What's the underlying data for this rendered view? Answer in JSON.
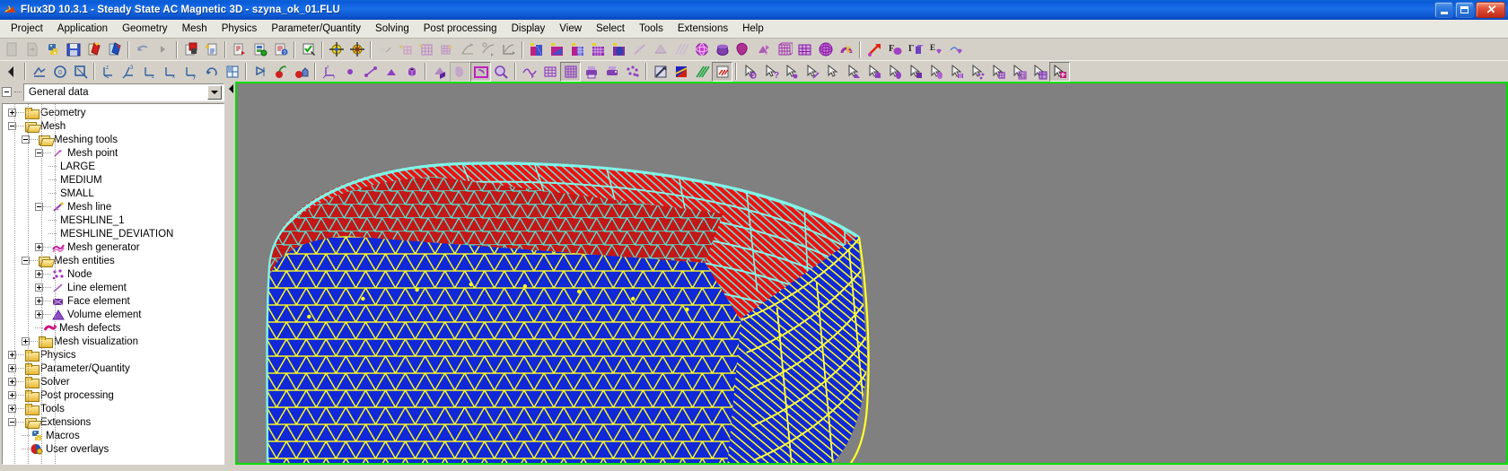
{
  "window": {
    "title": "Flux3D 10.3.1 - Steady State AC Magnetic 3D - szyna_ok_01.FLU",
    "app_icon": "flux3d-app-icon",
    "minimize_label": "",
    "restore_label": "",
    "close_label": "✕"
  },
  "menubar": {
    "items": [
      {
        "label": "Project",
        "name": "menu-project"
      },
      {
        "label": "Application",
        "name": "menu-application"
      },
      {
        "label": "Geometry",
        "name": "menu-geometry"
      },
      {
        "label": "Mesh",
        "name": "menu-mesh"
      },
      {
        "label": "Physics",
        "name": "menu-physics"
      },
      {
        "label": "Parameter/Quantity",
        "name": "menu-parameter-quantity"
      },
      {
        "label": "Solving",
        "name": "menu-solving"
      },
      {
        "label": "Post processing",
        "name": "menu-post-processing"
      },
      {
        "label": "Display",
        "name": "menu-display"
      },
      {
        "label": "View",
        "name": "menu-view"
      },
      {
        "label": "Select",
        "name": "menu-select"
      },
      {
        "label": "Tools",
        "name": "menu-tools"
      },
      {
        "label": "Extensions",
        "name": "menu-extensions"
      },
      {
        "label": "Help",
        "name": "menu-help"
      }
    ]
  },
  "toolbar_row1": {
    "buttons": [
      {
        "name": "new-project-icon",
        "kind": "page",
        "disabled": true
      },
      {
        "name": "open-project-icon",
        "kind": "page-arrow",
        "disabled": true
      },
      {
        "name": "python-macro-icon",
        "kind": "python",
        "disabled": false
      },
      {
        "name": "save-project-icon",
        "kind": "floppy",
        "disabled": false
      },
      {
        "name": "import-geometry-icon",
        "kind": "book-red",
        "disabled": false
      },
      {
        "name": "export-icon",
        "kind": "book-blue",
        "disabled": false
      },
      {
        "sep": true
      },
      {
        "name": "undo-icon",
        "kind": "undo",
        "disabled": true
      },
      {
        "name": "redo-icon",
        "kind": "redo-small",
        "disabled": true
      },
      {
        "sep": true
      },
      {
        "name": "project-manager-icon",
        "kind": "sheet-red",
        "disabled": false
      },
      {
        "name": "new-data-icon",
        "kind": "sheet-star",
        "disabled": false
      },
      {
        "sep": true
      },
      {
        "name": "material-import-icon",
        "kind": "sheet-arrow",
        "disabled": false
      },
      {
        "name": "material-manager-icon",
        "kind": "sheet-db",
        "disabled": false
      },
      {
        "name": "material-export-icon",
        "kind": "sheet-q",
        "disabled": false
      },
      {
        "sep": true
      },
      {
        "name": "check-data-icon",
        "kind": "check-doc",
        "disabled": false
      },
      {
        "sep": true
      },
      {
        "name": "coord-point-icon",
        "kind": "target-yellow",
        "disabled": false
      },
      {
        "name": "coord-point-add-icon",
        "kind": "target-yellow2",
        "disabled": false
      },
      {
        "sep": true
      },
      {
        "name": "mesh-point-icon",
        "kind": "star-line",
        "disabled": true
      },
      {
        "name": "mesh-line-icon",
        "kind": "grid-small",
        "disabled": true
      },
      {
        "name": "mesh-face-icon",
        "kind": "grid-purple",
        "disabled": true
      },
      {
        "name": "mesh-generate-icon",
        "kind": "grid-star",
        "disabled": true
      },
      {
        "name": "curve-icon",
        "kind": "curve1",
        "disabled": true
      },
      {
        "name": "curve2-icon",
        "kind": "curve2",
        "disabled": true
      },
      {
        "name": "curve3-icon",
        "kind": "curve3",
        "disabled": true
      },
      {
        "sep": true
      },
      {
        "name": "face-region-icon",
        "kind": "region-a",
        "disabled": false
      },
      {
        "name": "face-region2-icon",
        "kind": "region-b",
        "disabled": false
      },
      {
        "name": "volume-grid-icon",
        "kind": "region-c",
        "disabled": false
      },
      {
        "name": "volume-grid2-icon",
        "kind": "region-d",
        "disabled": false
      },
      {
        "name": "volume-solid-icon",
        "kind": "region-e",
        "disabled": false
      },
      {
        "name": "line-elem-icon",
        "kind": "line-elem",
        "disabled": true
      },
      {
        "name": "face-elem-icon",
        "kind": "face-elem",
        "disabled": true
      },
      {
        "name": "lines-elem-icon",
        "kind": "lines-elem",
        "disabled": true
      },
      {
        "name": "sphere-mesh-icon",
        "kind": "sphere-mesh",
        "disabled": false
      },
      {
        "name": "volume-elem-icon",
        "kind": "vol-elem",
        "disabled": false
      },
      {
        "name": "blob-icon",
        "kind": "blob",
        "disabled": false
      },
      {
        "name": "extrude-icon",
        "kind": "extrude",
        "disabled": false
      },
      {
        "name": "grid-cube-icon",
        "kind": "grid-cube",
        "disabled": false
      },
      {
        "name": "grid-cube2-icon",
        "kind": "grid-cube2",
        "disabled": false
      },
      {
        "name": "grid-sphere-icon",
        "kind": "grid-sphere",
        "disabled": false
      },
      {
        "name": "magnet-icon",
        "kind": "magnet",
        "disabled": false
      },
      {
        "sep": true
      },
      {
        "name": "arrow-vector-icon",
        "kind": "arrow-red",
        "disabled": false
      },
      {
        "name": "force-f-icon",
        "kind": "force-f",
        "disabled": false
      },
      {
        "name": "torque-gamma-icon",
        "kind": "torque-g",
        "disabled": false
      },
      {
        "name": "field-e-icon",
        "kind": "field-e",
        "disabled": false
      },
      {
        "name": "field-b-icon",
        "kind": "field-b",
        "disabled": false
      }
    ]
  },
  "toolbar_row2": {
    "buttons": [
      {
        "name": "scroll-left-icon",
        "kind": "scroll-left",
        "disabled": false
      },
      {
        "sep": true
      },
      {
        "name": "shade-icon",
        "kind": "shade",
        "disabled": false
      },
      {
        "name": "zoom-fit-icon",
        "kind": "zoom-circle",
        "disabled": false
      },
      {
        "name": "zoom-window-icon",
        "kind": "zoom-rect",
        "disabled": false
      },
      {
        "sep": true
      },
      {
        "name": "view-iso-icon",
        "kind": "axes-z",
        "disabled": false
      },
      {
        "name": "view-xyz-icon",
        "kind": "axes-3",
        "disabled": false
      },
      {
        "name": "view-z-icon",
        "kind": "axes-zz",
        "disabled": false
      },
      {
        "name": "view-x-icon",
        "kind": "axes-zx",
        "disabled": false
      },
      {
        "name": "view-y-icon",
        "kind": "axes-y",
        "disabled": false
      },
      {
        "name": "rotate-icon",
        "kind": "rotate",
        "disabled": false
      },
      {
        "name": "grid-view-icon",
        "kind": "grid-4",
        "disabled": false
      },
      {
        "sep": true
      },
      {
        "name": "clip-plane-icon",
        "kind": "clip",
        "disabled": false
      },
      {
        "name": "cherry-icon",
        "kind": "cherry",
        "disabled": false
      },
      {
        "name": "cherry-house-icon",
        "kind": "cherry-house",
        "disabled": false
      },
      {
        "sep": true
      },
      {
        "name": "axes-display-icon",
        "kind": "axes-disp",
        "disabled": false
      },
      {
        "name": "point-display-icon",
        "kind": "dot",
        "disabled": false
      },
      {
        "name": "line-display-icon",
        "kind": "segment",
        "disabled": false
      },
      {
        "name": "face-display-icon",
        "kind": "triangle",
        "disabled": false
      },
      {
        "name": "volume-display-icon",
        "kind": "cube",
        "disabled": false
      },
      {
        "sep": true
      },
      {
        "name": "solid-display-icon",
        "kind": "solid-cube",
        "disabled": false
      },
      {
        "name": "face-solid-icon",
        "kind": "solid-face",
        "disabled": true,
        "pressed": true
      },
      {
        "name": "select-region-icon",
        "kind": "sel-rect",
        "disabled": false,
        "pressed": true
      },
      {
        "name": "magnifier-icon",
        "kind": "magnifier",
        "disabled": false
      },
      {
        "sep": true
      },
      {
        "name": "spline-icon",
        "kind": "spline",
        "disabled": false
      },
      {
        "name": "mesh-grid-icon",
        "kind": "mesh-grid",
        "disabled": false
      },
      {
        "name": "mesh-grid-dense-icon",
        "kind": "mesh-dense",
        "disabled": false,
        "pressed": true
      },
      {
        "name": "printer-icon",
        "kind": "printer",
        "disabled": false
      },
      {
        "name": "printer2-icon",
        "kind": "printer2",
        "disabled": false
      },
      {
        "name": "node-display-icon",
        "kind": "nodes",
        "disabled": false
      },
      {
        "sep": true
      },
      {
        "name": "isovalue-icon",
        "kind": "iso-box",
        "disabled": false
      },
      {
        "name": "color-shade-icon",
        "kind": "colorramp",
        "disabled": false
      },
      {
        "name": "isolines-icon",
        "kind": "isolines",
        "disabled": false
      },
      {
        "name": "arrows-field-icon",
        "kind": "arrows-field",
        "disabled": false,
        "pressed": true
      },
      {
        "sep": true
      },
      {
        "name": "select-none-icon",
        "kind": "cur-none",
        "disabled": false
      },
      {
        "name": "select-help-icon",
        "kind": "cur-q",
        "disabled": false
      },
      {
        "name": "select-point-icon",
        "kind": "cur-dot",
        "disabled": false
      },
      {
        "name": "select-line-icon",
        "kind": "cur-line",
        "disabled": false
      },
      {
        "name": "select-arrow-icon",
        "kind": "cur-plain",
        "disabled": false
      },
      {
        "name": "select-face-icon",
        "kind": "cur-face",
        "disabled": false
      },
      {
        "name": "select-volume-icon",
        "kind": "cur-vol",
        "disabled": false
      },
      {
        "name": "select-solid-icon",
        "kind": "cur-solid",
        "disabled": false
      },
      {
        "name": "select-region-b-icon",
        "kind": "cur-regb",
        "disabled": false
      },
      {
        "name": "select-mesh-icon",
        "kind": "cur-mesh",
        "disabled": false
      },
      {
        "name": "select-mesh2-icon",
        "kind": "cur-mesh2",
        "disabled": false
      },
      {
        "name": "select-node-icon",
        "kind": "cur-node",
        "disabled": false
      },
      {
        "name": "select-elem-icon",
        "kind": "cur-elem",
        "disabled": false
      },
      {
        "name": "select-grid-icon",
        "kind": "cur-grid",
        "disabled": false
      },
      {
        "name": "select-grid2-icon",
        "kind": "cur-grid2",
        "disabled": false
      },
      {
        "name": "select-active-icon",
        "kind": "cur-active",
        "disabled": false,
        "pressed": true
      }
    ]
  },
  "sidebar": {
    "combo": {
      "value": "General data",
      "expander": "collapse-box",
      "arrow": "chevron-down-icon"
    },
    "tree": [
      {
        "label": "Geometry",
        "depth": 1,
        "box": "plus",
        "icon": "folder-closed",
        "name": "tree-item-geometry"
      },
      {
        "label": "Mesh",
        "depth": 1,
        "box": "minus",
        "icon": "folder-open",
        "name": "tree-item-mesh"
      },
      {
        "label": "Meshing tools",
        "depth": 2,
        "box": "minus",
        "icon": "folder-open",
        "name": "tree-item-meshing-tools"
      },
      {
        "label": "Mesh point",
        "depth": 3,
        "box": "minus",
        "icon": "mesh-point",
        "name": "tree-item-mesh-point"
      },
      {
        "label": "LARGE",
        "depth": 4,
        "box": "none",
        "icon": "none",
        "name": "tree-item-large"
      },
      {
        "label": "MEDIUM",
        "depth": 4,
        "box": "none",
        "icon": "none",
        "name": "tree-item-medium"
      },
      {
        "label": "SMALL",
        "depth": 4,
        "box": "none",
        "icon": "none",
        "name": "tree-item-small"
      },
      {
        "label": "Mesh line",
        "depth": 3,
        "box": "minus",
        "icon": "mesh-line",
        "name": "tree-item-mesh-line"
      },
      {
        "label": "MESHLINE_1",
        "depth": 4,
        "box": "none",
        "icon": "none",
        "name": "tree-item-meshline-1"
      },
      {
        "label": "MESHLINE_DEVIATION",
        "depth": 4,
        "box": "none",
        "icon": "none",
        "name": "tree-item-meshline-deviation"
      },
      {
        "label": "Mesh generator",
        "depth": 3,
        "box": "plus",
        "icon": "mesh-generator",
        "name": "tree-item-mesh-generator"
      },
      {
        "label": "Mesh entities",
        "depth": 2,
        "box": "minus",
        "icon": "folder-open",
        "name": "tree-item-mesh-entities"
      },
      {
        "label": "Node",
        "depth": 3,
        "box": "plus",
        "icon": "node",
        "name": "tree-item-node"
      },
      {
        "label": "Line element",
        "depth": 3,
        "box": "plus",
        "icon": "line-element",
        "name": "tree-item-line-element"
      },
      {
        "label": "Face element",
        "depth": 3,
        "box": "plus",
        "icon": "face-element",
        "name": "tree-item-face-element"
      },
      {
        "label": "Volume element",
        "depth": 3,
        "box": "plus",
        "icon": "volume-element",
        "name": "tree-item-volume-element"
      },
      {
        "label": "Mesh defects",
        "depth": 3,
        "box": "none",
        "icon": "mesh-defects",
        "name": "tree-item-mesh-defects"
      },
      {
        "label": "Mesh visualization",
        "depth": 2,
        "box": "plus",
        "icon": "folder-closed",
        "name": "tree-item-mesh-visualization"
      },
      {
        "label": "Physics",
        "depth": 1,
        "box": "plus",
        "icon": "folder-closed",
        "name": "tree-item-physics"
      },
      {
        "label": "Parameter/Quantity",
        "depth": 1,
        "box": "plus",
        "icon": "folder-closed",
        "name": "tree-item-parameter-quantity"
      },
      {
        "label": "Solver",
        "depth": 1,
        "box": "plus",
        "icon": "folder-closed",
        "name": "tree-item-solver"
      },
      {
        "label": "Post processing",
        "depth": 1,
        "box": "plus",
        "icon": "folder-closed",
        "name": "tree-item-post-processing"
      },
      {
        "label": "Tools",
        "depth": 1,
        "box": "plus",
        "icon": "folder-closed",
        "name": "tree-item-tools"
      },
      {
        "label": "Extensions",
        "depth": 1,
        "box": "minus",
        "icon": "folder-open",
        "name": "tree-item-extensions"
      },
      {
        "label": "Macros",
        "depth": 2,
        "box": "none",
        "icon": "python",
        "name": "tree-item-macros"
      },
      {
        "label": "User overlays",
        "depth": 2,
        "box": "none",
        "icon": "overlay",
        "name": "tree-item-user-overlays"
      }
    ]
  },
  "viewport": {
    "name": "mesh-3d-viewport",
    "border_color": "#00dd00",
    "background_color": "#808080",
    "regions": [
      {
        "name": "red-surface-mesh",
        "fill": "#ee1111",
        "line": "#40e0d0"
      },
      {
        "name": "blue-surface-mesh",
        "fill": "#1028d8",
        "line": "#ffff00"
      },
      {
        "name": "blue-quad-mesh",
        "fill": "#1028d8",
        "line": "#ffff00"
      },
      {
        "name": "red-transition-mesh",
        "fill": "#bb2222",
        "line": "#40e0d0"
      }
    ]
  },
  "colors": {
    "title_bar": "#0a5ad8",
    "menu_bg": "#e8e8e0",
    "toolbar_bg": "#d4d0c8",
    "viewport_bg": "#808080",
    "viewport_border": "#00dd00",
    "mesh_red": "#ee1111",
    "mesh_blue": "#1028d8",
    "mesh_cyan": "#40e0d0",
    "mesh_yellow": "#ffff00"
  }
}
